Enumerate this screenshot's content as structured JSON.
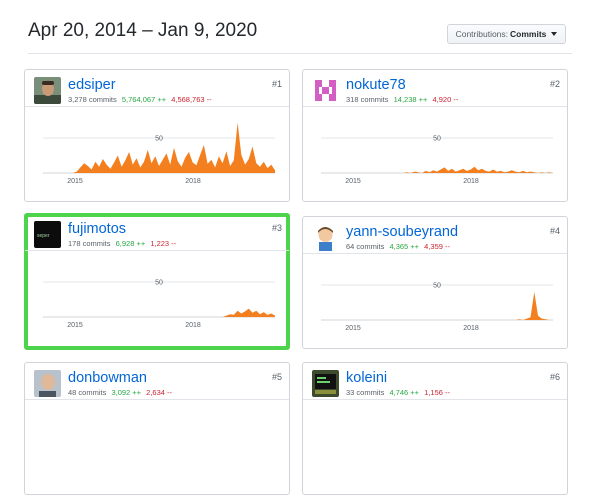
{
  "header": {
    "date_range": "Apr 20, 2014 – Jan 9, 2020",
    "contributions_label": "Contributions:",
    "contributions_value": "Commits"
  },
  "colors": {
    "area": "#f37f1f",
    "link": "#0366d6",
    "additions": "#28a745",
    "deletions": "#cb2431",
    "highlight": "#4cd44c"
  },
  "cards": [
    {
      "rank": "#1",
      "username": "edsiper",
      "commits": "3,278 commits",
      "additions": "5,764,067 ++",
      "deletions": "4,568,763 --",
      "avatar": "photo-avatar",
      "highlighted": false
    },
    {
      "rank": "#2",
      "username": "nokute78",
      "commits": "318 commits",
      "additions": "14,238 ++",
      "deletions": "4,920 --",
      "avatar": "identicon-avatar",
      "highlighted": false
    },
    {
      "rank": "#3",
      "username": "fujimotos",
      "commits": "178 commits",
      "additions": "6,928 ++",
      "deletions": "1,223 --",
      "avatar": "dark-logo-avatar",
      "highlighted": true
    },
    {
      "rank": "#4",
      "username": "yann-soubeyrand",
      "commits": "64 commits",
      "additions": "4,365 ++",
      "deletions": "4,359 --",
      "avatar": "cartoon-avatar",
      "highlighted": false
    },
    {
      "rank": "#5",
      "username": "donbowman",
      "commits": "48 commits",
      "additions": "3,092 ++",
      "deletions": "2,634 --",
      "avatar": "photo-avatar",
      "highlighted": false
    },
    {
      "rank": "#6",
      "username": "koleini",
      "commits": "33 commits",
      "additions": "4,746 ++",
      "deletions": "1,156 --",
      "avatar": "terminal-avatar",
      "highlighted": false
    }
  ],
  "chart_data": [
    {
      "type": "area",
      "series": [
        {
          "values": [
            0,
            0,
            0,
            0,
            0,
            0,
            0,
            0,
            0,
            2,
            8,
            14,
            10,
            5,
            16,
            9,
            20,
            12,
            6,
            15,
            25,
            9,
            18,
            30,
            12,
            21,
            8,
            16,
            33,
            14,
            24,
            10,
            19,
            28,
            12,
            36,
            17,
            9,
            22,
            30,
            15,
            11,
            26,
            40,
            13,
            19,
            8,
            24,
            14,
            31,
            10,
            18,
            72,
            26,
            12,
            20,
            38,
            14,
            9,
            16,
            7,
            12,
            4
          ]
        }
      ],
      "xlabels": [
        "2015",
        "2018"
      ],
      "ytick": "50",
      "ymax": 80
    },
    {
      "type": "area",
      "series": [
        {
          "values": [
            0,
            0,
            0,
            0,
            0,
            0,
            0,
            0,
            0,
            0,
            0,
            0,
            0,
            0,
            0,
            0,
            0,
            0,
            0,
            0,
            0,
            0,
            0,
            1,
            0,
            2,
            1,
            0,
            3,
            1,
            4,
            2,
            5,
            8,
            3,
            6,
            2,
            4,
            6,
            3,
            5,
            9,
            4,
            6,
            3,
            2,
            5,
            2,
            3,
            1,
            2,
            4,
            2,
            1,
            3,
            1,
            2,
            1,
            0,
            1,
            0,
            1,
            0
          ]
        }
      ],
      "xlabels": [
        "2015",
        "2018"
      ],
      "ytick": "50",
      "ymax": 80
    },
    {
      "type": "area",
      "series": [
        {
          "values": [
            0,
            0,
            0,
            0,
            0,
            0,
            0,
            0,
            0,
            0,
            0,
            0,
            0,
            0,
            0,
            0,
            0,
            0,
            0,
            0,
            0,
            0,
            0,
            0,
            0,
            0,
            0,
            0,
            0,
            0,
            0,
            0,
            0,
            0,
            0,
            0,
            0,
            0,
            0,
            0,
            0,
            0,
            0,
            0,
            0,
            0,
            0,
            0,
            0,
            2,
            4,
            3,
            9,
            5,
            8,
            12,
            6,
            9,
            4,
            7,
            3,
            5,
            2
          ]
        }
      ],
      "xlabels": [
        "2015",
        "2018"
      ],
      "ytick": "50",
      "ymax": 80
    },
    {
      "type": "area",
      "series": [
        {
          "values": [
            0,
            0,
            0,
            0,
            0,
            0,
            0,
            0,
            0,
            0,
            0,
            0,
            0,
            0,
            0,
            0,
            0,
            0,
            0,
            0,
            0,
            0,
            0,
            0,
            0,
            0,
            0,
            0,
            0,
            0,
            0,
            0,
            0,
            0,
            0,
            0,
            0,
            0,
            0,
            0,
            0,
            0,
            0,
            0,
            0,
            0,
            0,
            0,
            0,
            0,
            0,
            0,
            0,
            1,
            0,
            2,
            4,
            40,
            6,
            2,
            1,
            0,
            0
          ]
        }
      ],
      "xlabels": [
        "2015",
        "2018"
      ],
      "ytick": "50",
      "ymax": 80
    }
  ]
}
